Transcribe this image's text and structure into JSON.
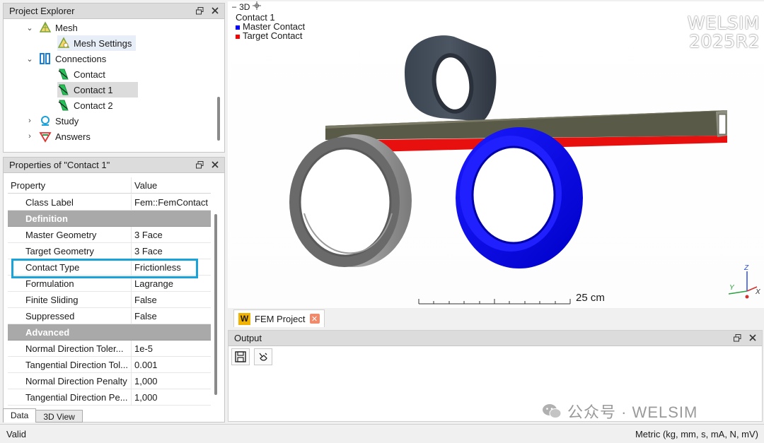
{
  "explorer": {
    "title": "Project Explorer",
    "items": [
      {
        "label": "Mesh",
        "chev": "⌄"
      },
      {
        "label": "Mesh Settings"
      },
      {
        "label": "Connections",
        "chev": "⌄"
      },
      {
        "label": "Contact"
      },
      {
        "label": "Contact 1"
      },
      {
        "label": "Contact 2"
      },
      {
        "label": "Study",
        "chev": "›"
      },
      {
        "label": "Answers",
        "chev": "›"
      }
    ]
  },
  "properties": {
    "title": "Properties of \"Contact 1\"",
    "header": {
      "name": "Property",
      "value": "Value"
    },
    "rows": [
      {
        "name": "Class Label",
        "value": "Fem::FemContact"
      },
      {
        "name": "Definition",
        "value": ""
      },
      {
        "name": "Master Geometry",
        "value": "3 Face"
      },
      {
        "name": "Target Geometry",
        "value": "3 Face"
      },
      {
        "name": "Contact Type",
        "value": "Frictionless"
      },
      {
        "name": "Formulation",
        "value": "Lagrange"
      },
      {
        "name": "Finite Sliding",
        "value": "False"
      },
      {
        "name": "Suppressed",
        "value": "False"
      },
      {
        "name": "Advanced",
        "value": ""
      },
      {
        "name": "Normal Direction Toler...",
        "value": "1e-5"
      },
      {
        "name": "Tangential Direction Tol...",
        "value": "0.001"
      },
      {
        "name": "Normal Direction Penalty",
        "value": "1,000"
      },
      {
        "name": "Tangential Direction Pe...",
        "value": "1,000"
      }
    ]
  },
  "bottom_tabs": [
    "Data",
    "3D View"
  ],
  "status": {
    "left": "Valid",
    "right": "Metric (kg, mm, s, mA, N, mV)"
  },
  "view3d": {
    "tab": "3D",
    "legend": {
      "title": "Contact 1",
      "master": "Master Contact",
      "target": "Target Contact"
    },
    "brand_line1": "WELSIM",
    "brand_line2": "2025R2",
    "scale": "25 cm",
    "axis_labels": {
      "x": "X",
      "y": "Y",
      "z": "Z"
    }
  },
  "doc_tab": {
    "icon": "W",
    "label": "FEM Project"
  },
  "output": {
    "title": "Output"
  },
  "watermark": "公众号 · WELSIM",
  "colors": {
    "master": "#0000ff",
    "target": "#ff0000",
    "highlight": "#1aa3d8"
  }
}
